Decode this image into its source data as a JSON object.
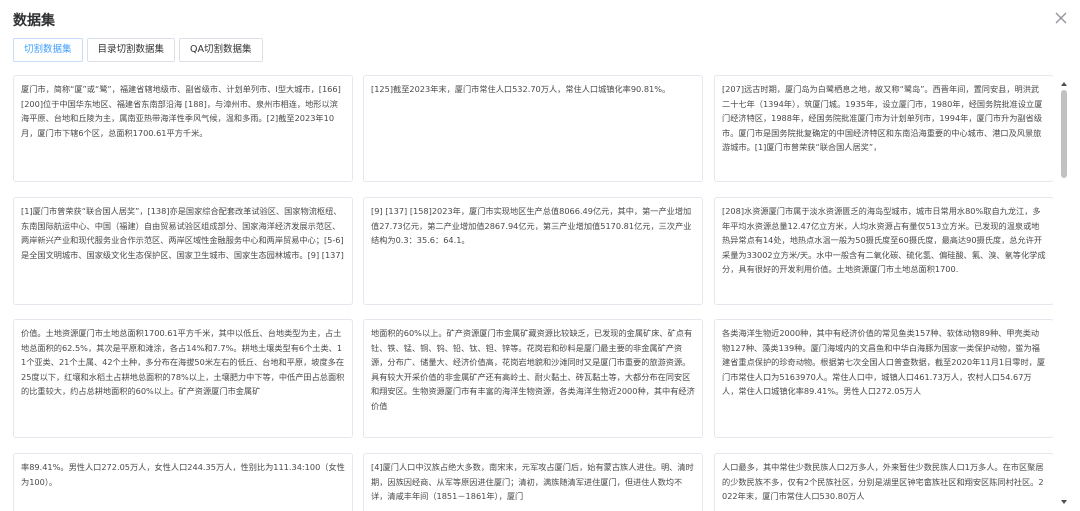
{
  "dialog": {
    "title": "数据集",
    "close_icon": "close-icon"
  },
  "tabs": [
    {
      "label": "切割数据集",
      "active": true
    },
    {
      "label": "目录切割数据集",
      "active": false
    },
    {
      "label": "QA切割数据集",
      "active": false
    }
  ],
  "cards": [
    {
      "text": "厦门市，简称“厦”或“鹭”，福建省辖地级市、副省级市、计划单列市、Ⅰ型大城市，[166] [200]位于中国华东地区、福建省东南部沿海 [188]，与漳州市、泉州市相连，地形以滨海平原、台地和丘陵为主，属南亚热带海洋性季风气候，温和多雨。[2]截至2023年10月，厦门市下辖6个区，总面积1700.61平方千米。"
    },
    {
      "text": "[125]截至2023年末，厦门市常住人口532.70万人，常住人口城镇化率90.81%。"
    },
    {
      "text": "[207]远古时期，厦门岛为白鹭栖息之地，故又称“鹭岛”。西晋年间，置同安县，明洪武二十七年（1394年），筑厦门城。1935年，设立厦门市，1980年，经国务院批准设立厦门经济特区，1988年，经国务院批准厦门市为计划单列市，1994年，厦门市升为副省级市。厦门市是国务院批复确定的中国经济特区和东南沿海重要的中心城市、港口及风景旅游城市。[1]厦门市曾荣获“联合国人居奖”，"
    },
    {
      "text": "[1]厦门市曾荣获“联合国人居奖”，[138]亦是国家综合配套改革试验区、国家物流枢纽、东南国际航运中心、中国（福建）自由贸易试验区组成部分、国家海洋经济发展示范区、两岸新兴产业和现代服务业合作示范区、两岸区域性金融服务中心和两岸贸易中心；[5-6]是全国文明城市、国家级文化生态保护区、国家卫生城市、国家生态园林城市。[9] [137]"
    },
    {
      "text": "[9] [137] [158]2023年，厦门市实现地区生产总值8066.49亿元，其中，第一产业增加值27.73亿元，第二产业增加值2867.94亿元，第三产业增加值5170.81亿元，三次产业结构为0.3：35.6：64.1。"
    },
    {
      "text": "[208]水资源厦门市属于淡水资源匮乏的海岛型城市，城市日常用水80%取自九龙江，多年平均水资源总量12.47亿立方米，人均水资源占有量仅513立方米。已发现的温泉或地热异常点有14处，地热点水温一般为50摄氏度至60摄氏度，最高达90摄氏度，总允许开采量为33002立方米/天。水中一般含有二氧化碳、硫化氢、偏硅酸、氟、溴、氡等化学成分，具有很好的开发利用价值。土地资源厦门市土地总面积1700."
    },
    {
      "text": "价值。土地资源厦门市土地总面积1700.61平方千米，其中以低丘、台地类型为主，占土地总面积的62.5%，其次是平原和滩涂，各占14%和7.7%。耕地土壤类型有6个土类、11个亚类、21个土属、42个土种，多分布在海拔50米左右的低丘、台地和平原，坡度多在25度以下，红壤和水稻土占耕地总面积的78%以上，土壤肥力中下等，中低产田占总面积的比重较大，约占总耕地面积的60%以上。矿产资源厦门市金属矿"
    },
    {
      "text": "地面积的60%以上。矿产资源厦门市金属矿藏资源比较缺乏，已发现的金属矿床、矿点有钍、铁、锰、铜、钨、铅、钛、钽、锌等。花岗岩和砂料是厦门最主要的非金属矿产资源，分布广、储量大、经济价值高，花岗岩地貌和沙滩同时又是厦门市重要的旅游资源。具有较大开采价值的非金属矿产还有高岭土、耐火黏土、砖瓦黏土等，大都分布在同安区和翔安区。生物资源厦门市有丰富的海洋生物资源，各类海洋生物近2000种，其中有经济价值"
    },
    {
      "text": "各类海洋生物近2000种，其中有经济价值的常见鱼类157种、软体动物89种、甲壳类动物127种、藻类139种。厦门海域内的文昌鱼和中华白海豚为国家一类保护动物，鲎为福建省重点保护的珍奇动物。根据第七次全国人口普查数据，截至2020年11月1日零时，厦门市常住人口为5163970人。常住人口中，城镇人口461.73万人，农村人口54.67万人，常住人口城镇化率89.41%。男性人口272.05万人"
    },
    {
      "text": "率89.41%。男性人口272.05万人，女性人口244.35万人，性别比为111.34:100（女性为100）。"
    },
    {
      "text": "[4]厦门人口中汉族占绝大多数，南宋末，元军攻占厦门后，始有蒙古族人进住。明、清时期，因族因经商、从军等原因进住厦门；清初，满族随清军进住厦门，但进住人数均不详，清咸丰年间（1851－1861年），厦门"
    },
    {
      "text": "人口最多，其中常住少数民族人口2万多人，外来暂住少数民族人口1万多人。在市区聚居的少数民族不多，仅有2个民族社区，分别是湖里区钟宅畲族社区和翔安区陈同村社区。2022年末，厦门市常住人口530.80万人"
    }
  ]
}
